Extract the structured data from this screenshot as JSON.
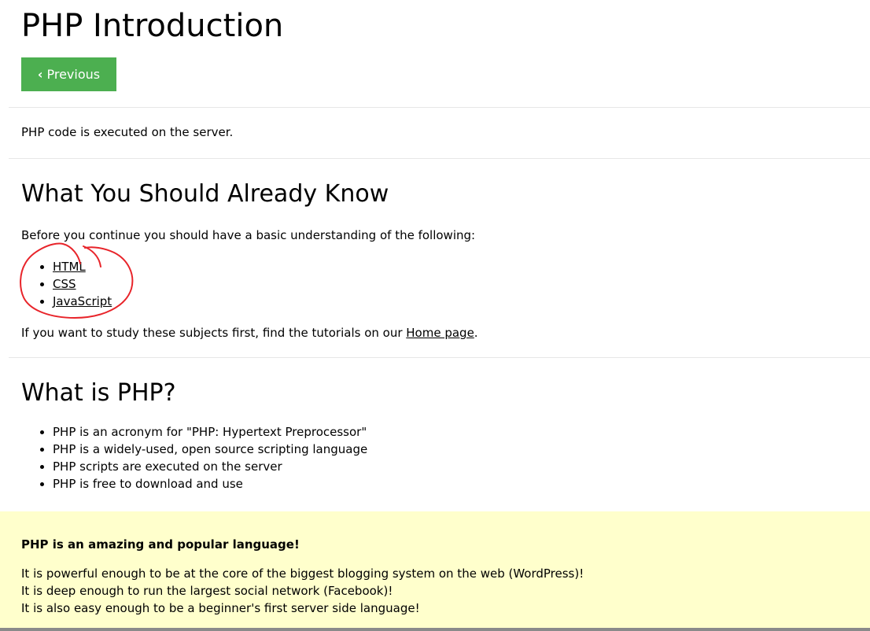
{
  "page": {
    "title": "PHP Introduction",
    "previous_label": "Previous"
  },
  "intro": {
    "text": "PHP code is executed on the server."
  },
  "prereq": {
    "heading": "What You Should Already Know",
    "lead": "Before you continue you should have a basic understanding of the following:",
    "items": [
      "HTML",
      "CSS",
      "JavaScript"
    ],
    "outro_before": "If you want to study these subjects first, find the tutorials on our ",
    "outro_link": "Home page",
    "outro_after": "."
  },
  "what_is": {
    "heading": "What is PHP?",
    "items": [
      "PHP is an acronym for \"PHP: Hypertext Preprocessor\"",
      "PHP is a widely-used, open source scripting language",
      "PHP scripts are executed on the server",
      "PHP is free to download and use"
    ]
  },
  "note": {
    "title": "PHP is an amazing and popular language!",
    "lines": [
      "It is powerful enough to be at the core of the biggest blogging system on the web (WordPress)!",
      "It is deep enough to run the largest social network (Facebook)!",
      "It is also easy enough to be a beginner's first server side language!"
    ]
  },
  "colors": {
    "button_green": "#4CAF50",
    "note_background": "#ffffcc",
    "annotation_red": "#e8242a"
  }
}
